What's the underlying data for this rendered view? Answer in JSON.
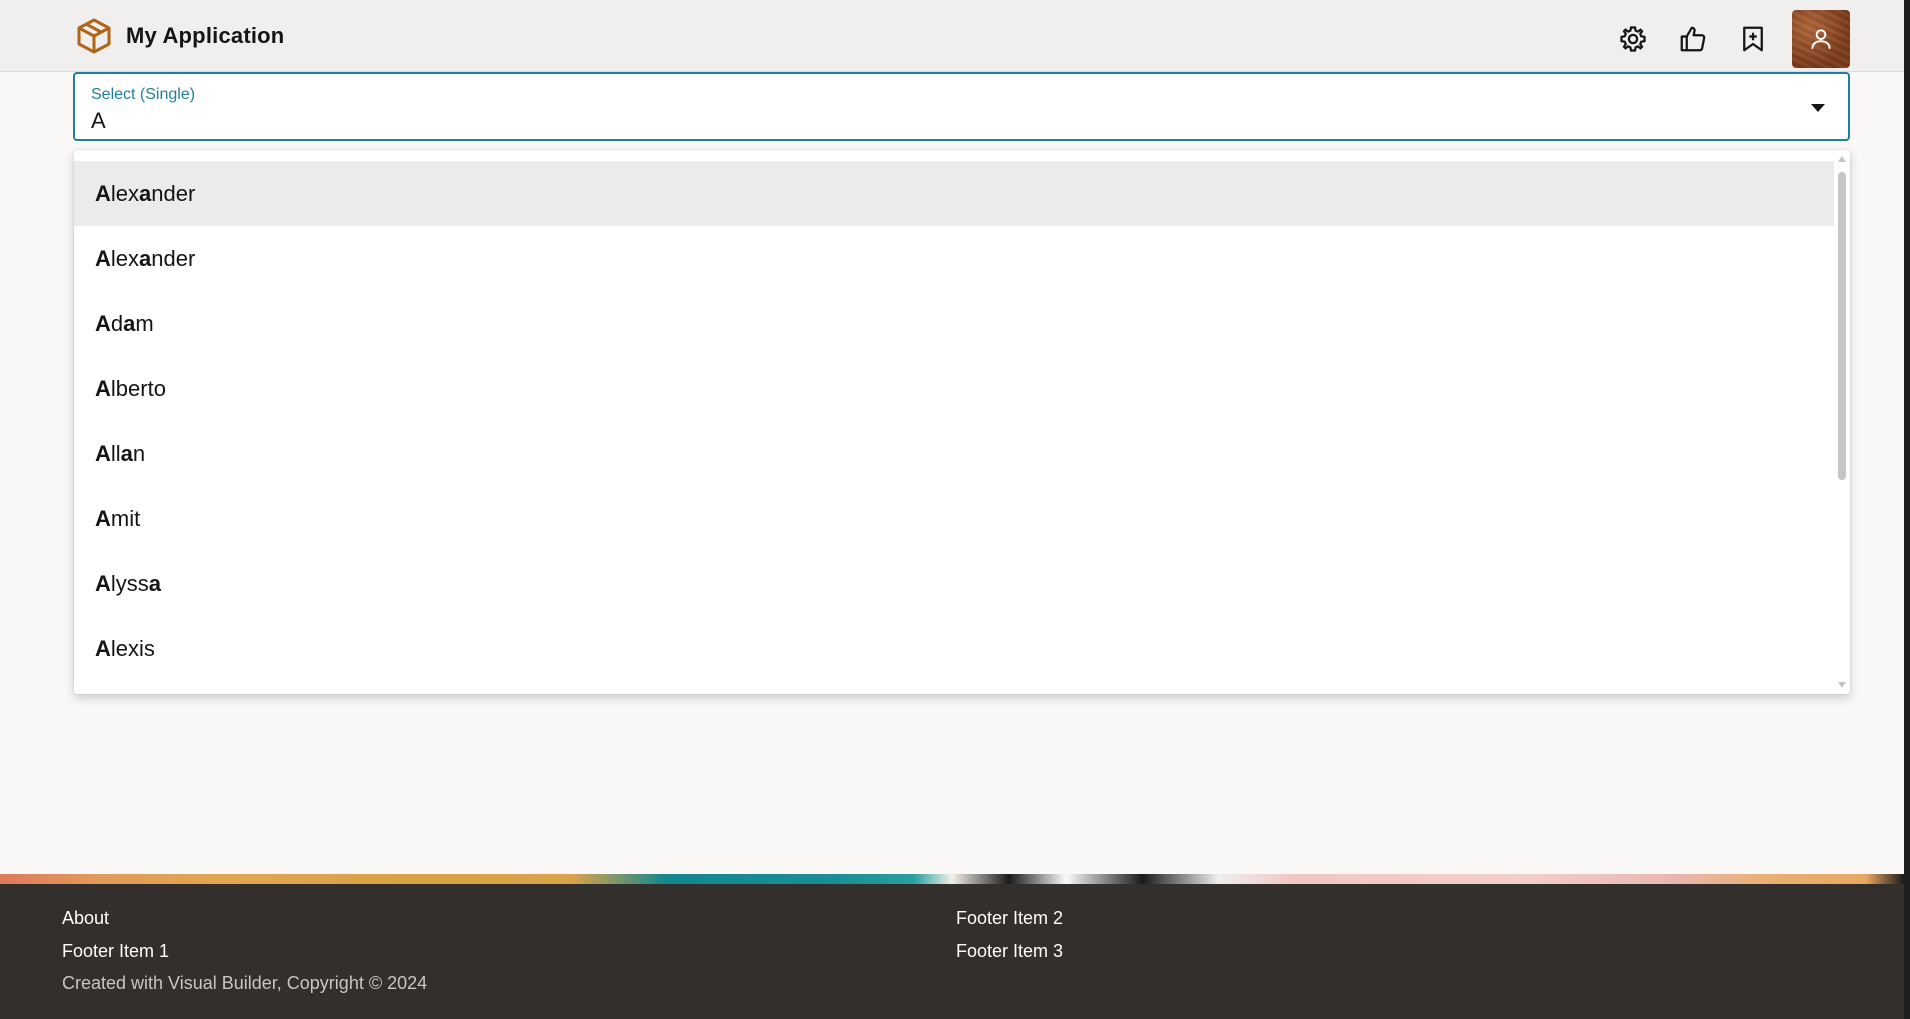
{
  "header": {
    "app_title": "My Application",
    "actions": [
      {
        "name": "settings",
        "icon": "gear-icon"
      },
      {
        "name": "like",
        "icon": "thumbs-up-icon"
      },
      {
        "name": "bookmark",
        "icon": "bookmark-add-icon"
      }
    ],
    "avatar_icon": "user-icon"
  },
  "select": {
    "label": "Select (Single)",
    "value": "A"
  },
  "dropdown": {
    "options": [
      {
        "parts": [
          {
            "t": "A",
            "b": true
          },
          {
            "t": "lex",
            "b": false
          },
          {
            "t": "a",
            "b": true
          },
          {
            "t": "nder",
            "b": false
          }
        ],
        "active": true
      },
      {
        "parts": [
          {
            "t": "A",
            "b": true
          },
          {
            "t": "lex",
            "b": false
          },
          {
            "t": "a",
            "b": true
          },
          {
            "t": "nder",
            "b": false
          }
        ],
        "active": false
      },
      {
        "parts": [
          {
            "t": "A",
            "b": true
          },
          {
            "t": "d",
            "b": false
          },
          {
            "t": "a",
            "b": true
          },
          {
            "t": "m",
            "b": false
          }
        ],
        "active": false
      },
      {
        "parts": [
          {
            "t": "A",
            "b": true
          },
          {
            "t": "lberto",
            "b": false
          }
        ],
        "active": false
      },
      {
        "parts": [
          {
            "t": "A",
            "b": true
          },
          {
            "t": "ll",
            "b": false
          },
          {
            "t": "a",
            "b": true
          },
          {
            "t": "n",
            "b": false
          }
        ],
        "active": false
      },
      {
        "parts": [
          {
            "t": "A",
            "b": true
          },
          {
            "t": "mit",
            "b": false
          }
        ],
        "active": false
      },
      {
        "parts": [
          {
            "t": "A",
            "b": true
          },
          {
            "t": "lyss",
            "b": false
          },
          {
            "t": "a",
            "b": true
          }
        ],
        "active": false
      },
      {
        "parts": [
          {
            "t": "A",
            "b": true
          },
          {
            "t": "lexis",
            "b": false
          }
        ],
        "active": false
      }
    ]
  },
  "footer": {
    "about": "About",
    "item1": "Footer Item 1",
    "item2": "Footer Item 2",
    "item3": "Footer Item 3",
    "copyright": "Created with Visual Builder, Copyright © 2024"
  },
  "colors": {
    "accent": "#227e9e",
    "header_bg": "#f1efed",
    "footer_bg": "#322f2c",
    "logo": "#b0651a",
    "active_option_bg": "#ecebe9"
  }
}
